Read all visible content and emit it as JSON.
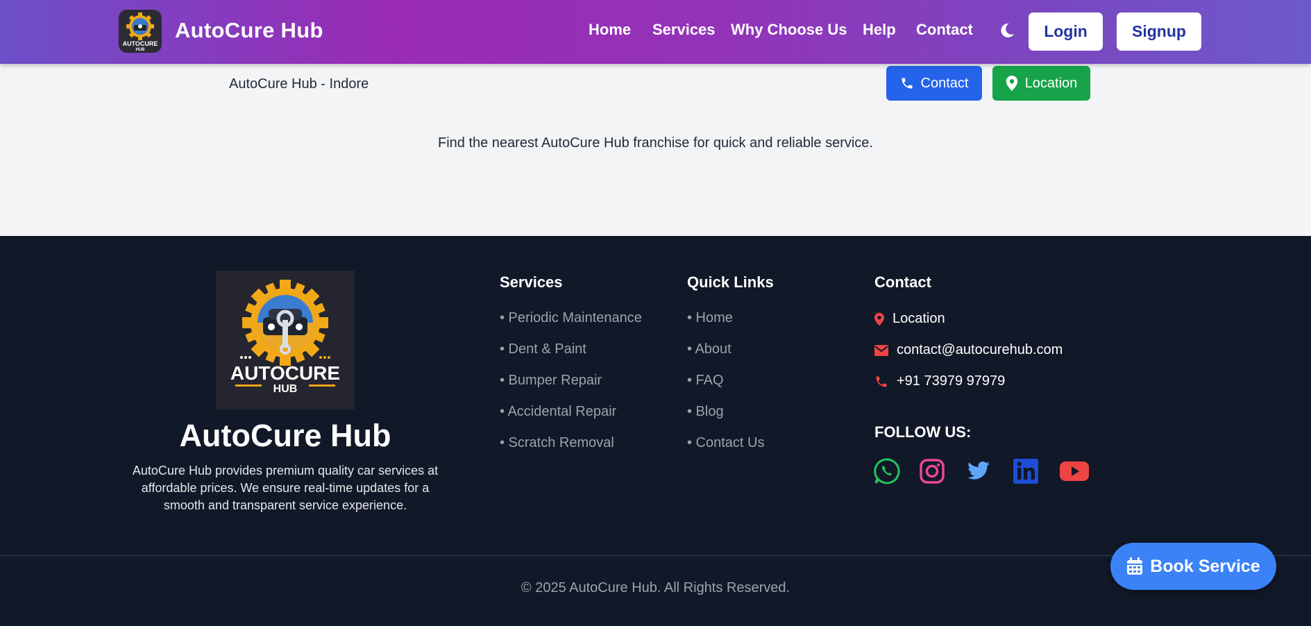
{
  "header": {
    "brand": "AutoCure Hub",
    "logo_text": "AUTOCURE",
    "logo_subtext": "HUB",
    "nav": [
      "Home",
      "Services",
      "Why Choose Us",
      "Help",
      "Contact"
    ],
    "login": "Login",
    "signup": "Signup"
  },
  "location_bar": {
    "name": "AutoCure Hub - Indore",
    "contact_button": "Contact",
    "location_button": "Location",
    "tagline": "Find the nearest AutoCure Hub franchise for quick and reliable service."
  },
  "footer": {
    "brand": "AutoCure Hub",
    "logo_text": "AUTOCURE",
    "logo_subtext": "HUB",
    "description": "AutoCure Hub provides premium quality car services at affordable prices. We ensure real-time updates for a smooth and transparent service experience.",
    "services": {
      "heading": "Services",
      "items": [
        "• Periodic Maintenance",
        "• Dent & Paint",
        "• Bumper Repair",
        "• Accidental Repair",
        "• Scratch Removal"
      ]
    },
    "quick_links": {
      "heading": "Quick Links",
      "items": [
        "• Home",
        "• About",
        "• FAQ",
        "• Blog",
        "• Contact Us"
      ]
    },
    "contact": {
      "heading": "Contact",
      "location": "Location",
      "email": "contact@autocurehub.com",
      "phone": "+91 73979 97979"
    },
    "follow_label": "FOLLOW US:",
    "social_icons": [
      "whatsapp-icon",
      "instagram-icon",
      "twitter-icon",
      "linkedin-icon",
      "youtube-icon"
    ],
    "copyright": "© 2025 AutoCure Hub. All Rights Reserved."
  },
  "book_button": "Book Service",
  "colors": {
    "header_gradient_start": "#6d4fc9",
    "header_gradient_mid": "#9a2bb4",
    "primary_blue": "#2563eb",
    "success_green": "#16a34a",
    "footer_bg": "#111827",
    "accent_red": "#ef4444",
    "book_button": "#3b82f6"
  }
}
